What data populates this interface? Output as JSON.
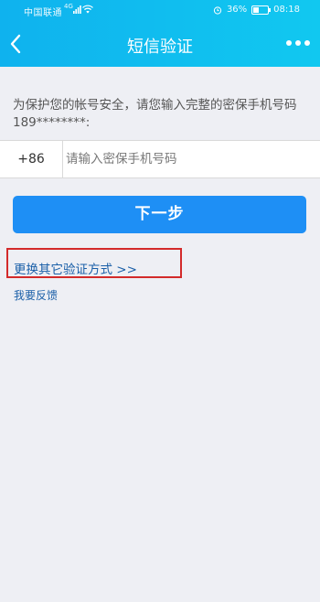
{
  "status_bar": {
    "carrier": "中国联通",
    "network": "4G",
    "battery": "36%",
    "battery_level": 0.36,
    "time": "08:18"
  },
  "header": {
    "title": "短信验证",
    "back_icon": "chevron-left-icon",
    "more_icon": "more-dots-icon"
  },
  "instruction": "为保护您的帐号安全，请您输入完整的密保手机号码189********:",
  "phone_form": {
    "country_code": "+86",
    "placeholder": "请输入密保手机号码",
    "value": ""
  },
  "next_button_label": "下一步",
  "links": {
    "switch_method": "更换其它验证方式 >>",
    "feedback": "我要反馈"
  },
  "colors": {
    "header": "#11c8f0",
    "primary_button": "#1e8ff5",
    "link": "#1a5fa8",
    "highlight_box": "#d32a2a",
    "background": "#eeeff4"
  }
}
